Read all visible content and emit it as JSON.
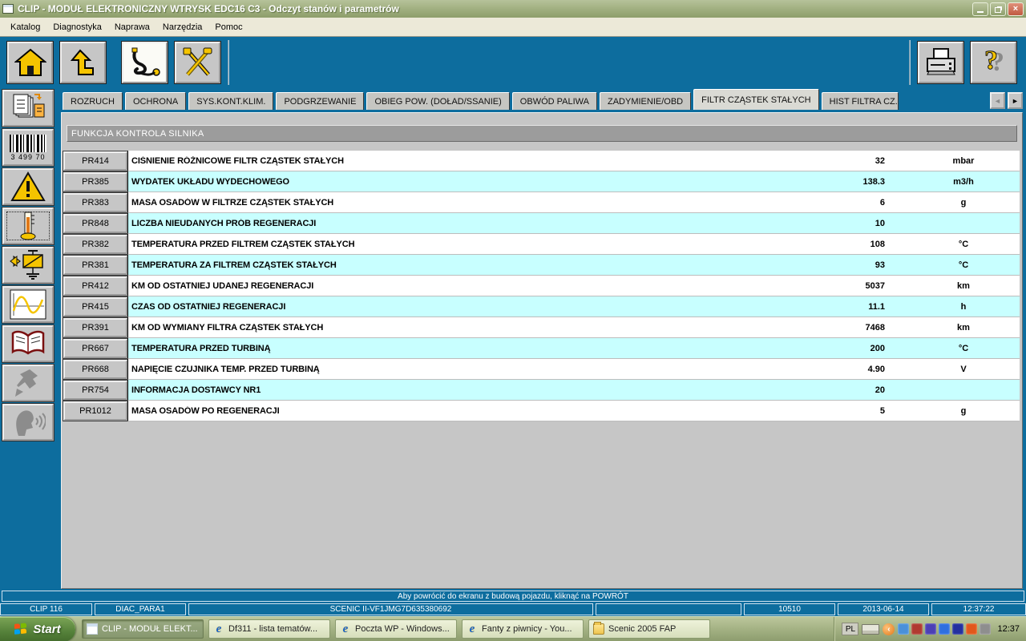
{
  "window": {
    "title": "CLIP - MODUŁ ELEKTRONICZNY WTRYSK EDC16 C3 - Odczyt stanów i parametrów"
  },
  "menu": {
    "items": [
      "Katalog",
      "Diagnostyka",
      "Naprawa",
      "Narzędzia",
      "Pomoc"
    ]
  },
  "toolbar": {
    "icons": [
      "home-icon",
      "up-arrow-icon",
      "stethoscope-icon",
      "tools-icon",
      "printer-icon",
      "help-icon"
    ]
  },
  "sidebar": {
    "icons": [
      "report-pages-icon",
      "barcode-icon",
      "warning-icon",
      "thermometer-icon",
      "actuator-icon",
      "oscilloscope-icon",
      "manual-book-icon",
      "pin-icon",
      "voice-icon"
    ],
    "barcode_text": "3 499 70"
  },
  "tabs": {
    "items": [
      {
        "label": "ROZRUCH",
        "name": "tab-rozruch"
      },
      {
        "label": "OCHRONA",
        "name": "tab-ochrona"
      },
      {
        "label": "SYS.KONT.KLIM.",
        "name": "tab-sys-kont-klim"
      },
      {
        "label": "PODGRZEWANIE",
        "name": "tab-podgrzewanie"
      },
      {
        "label": "OBIEG POW. (DOŁAD/SSANIE)",
        "name": "tab-obieg-pow"
      },
      {
        "label": "OBWÓD PALIWA",
        "name": "tab-obwod-paliwa"
      },
      {
        "label": "ZADYMIENIE/OBD",
        "name": "tab-zadymienie-obd"
      },
      {
        "label": "FILTR CZĄSTEK STAŁYCH",
        "name": "tab-filtr-czastek-stalych",
        "active": true
      },
      {
        "label": "HIST FILTRA CZ.",
        "name": "tab-hist-filtra-cz"
      }
    ],
    "scroll_left": "◄",
    "scroll_right": "►"
  },
  "content": {
    "function_header": "FUNKCJA KONTROLA SILNIKA",
    "rows": [
      {
        "code": "PR414",
        "label": "CIŚNIENIE RÓŻNICOWE FILTR CZĄSTEK STAŁYCH",
        "value": "32",
        "unit": "mbar"
      },
      {
        "code": "PR385",
        "label": "WYDATEK UKŁADU WYDECHOWEGO",
        "value": "138.3",
        "unit": "m3/h"
      },
      {
        "code": "PR383",
        "label": "MASA OSADÓW W FILTRZE CZĄSTEK STAŁYCH",
        "value": "6",
        "unit": "g"
      },
      {
        "code": "PR848",
        "label": "LICZBA NIEUDANYCH PRÓB REGENERACJI",
        "value": "10",
        "unit": ""
      },
      {
        "code": "PR382",
        "label": "TEMPERATURA PRZED FILTREM CZĄSTEK STAŁYCH",
        "value": "108",
        "unit": "°C"
      },
      {
        "code": "PR381",
        "label": "TEMPERATURA ZA FILTREM CZĄSTEK STAŁYCH",
        "value": "93",
        "unit": "°C"
      },
      {
        "code": "PR412",
        "label": "KM OD OSTATNIEJ UDANEJ REGENERACJI",
        "value": "5037",
        "unit": "km"
      },
      {
        "code": "PR415",
        "label": "CZAS OD OSTATNIEJ REGENERACJI",
        "value": "11.1",
        "unit": "h"
      },
      {
        "code": "PR391",
        "label": "KM OD WYMIANY FILTRA CZĄSTEK STAŁYCH",
        "value": "7468",
        "unit": "km"
      },
      {
        "code": "PR667",
        "label": "TEMPERATURA PRZED TURBINĄ",
        "value": "200",
        "unit": "°C"
      },
      {
        "code": "PR668",
        "label": "NAPIĘCIE CZUJNIKA TEMP. PRZED TURBINĄ",
        "value": "4.90",
        "unit": "V"
      },
      {
        "code": "PR754",
        "label": "INFORMACJA DOSTAWCY NR1",
        "value": "20",
        "unit": ""
      },
      {
        "code": "PR1012",
        "label": "MASA OSADÓW PO REGENERACJI",
        "value": "5",
        "unit": "g"
      }
    ]
  },
  "message_bar": {
    "text": "Aby powrócić do ekranu z budową pojazdu, kliknąć na POWRÓT"
  },
  "status_bar": {
    "cells": [
      "CLIP 116",
      "DIAC_PARA1",
      "SCENIC II-VF1JMG7D635380692",
      "",
      "10510",
      "2013-06-14",
      "12:37:22"
    ]
  },
  "taskbar": {
    "start_label": "Start",
    "buttons": [
      {
        "label": "CLIP - MODUŁ ELEKT...",
        "icon": "window",
        "name": "taskbar-button-clip",
        "active": true
      },
      {
        "label": "Df311 - lista tematów...",
        "icon": "ie",
        "name": "taskbar-button-df311"
      },
      {
        "label": "Poczta WP - Windows...",
        "icon": "ie",
        "name": "taskbar-button-poczta-wp"
      },
      {
        "label": "Fanty z piwnicy - You...",
        "icon": "ie",
        "name": "taskbar-button-fanty"
      },
      {
        "label": "Scenic 2005 FAP",
        "icon": "folder",
        "name": "taskbar-button-scenic-folder"
      }
    ],
    "tray": {
      "language": "PL",
      "clock": "12:37",
      "icons": [
        {
          "name": "network-activity-icon",
          "color": "#4a90d9"
        },
        {
          "name": "network-offline-icon",
          "color": "#b03a30"
        },
        {
          "name": "usb-device-icon",
          "color": "#4b3fb5"
        },
        {
          "name": "messenger-icon",
          "color": "#2f6fe0"
        },
        {
          "name": "antivirus-icon",
          "color": "#23309f"
        },
        {
          "name": "updater-icon",
          "color": "#e2571b"
        },
        {
          "name": "display-settings-icon",
          "color": "#8e8e8e"
        }
      ]
    }
  },
  "colors": {
    "app_background": "#0d6d9e",
    "row_stripe": "#c8ffff",
    "titlebar_olive": "#9fae7e",
    "icon_yellow": "#f5c400"
  }
}
